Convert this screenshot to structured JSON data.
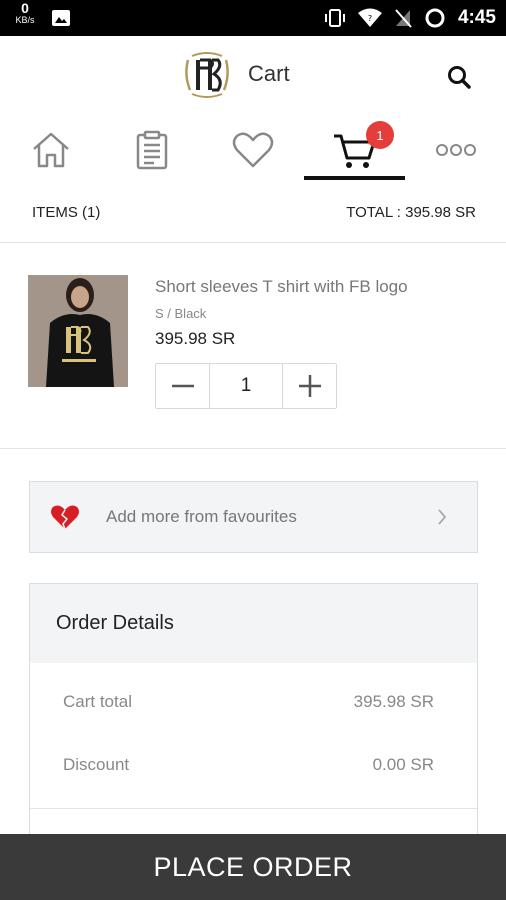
{
  "status_bar": {
    "net_speed": "0",
    "net_unit": "KB/s",
    "time": "4:45"
  },
  "header": {
    "title": "Cart"
  },
  "tabs": [
    {
      "name": "home",
      "icon": "home-icon"
    },
    {
      "name": "orders",
      "icon": "clipboard-icon"
    },
    {
      "name": "favourites",
      "icon": "heart-icon"
    },
    {
      "name": "cart",
      "icon": "cart-icon",
      "badge": "1",
      "active": true
    },
    {
      "name": "more",
      "icon": "more-icon"
    }
  ],
  "summary": {
    "items": "ITEMS (1)",
    "total": "TOTAL : 395.98 SR"
  },
  "cart_item": {
    "name": "Short sleeves T shirt with FB logo",
    "variant": "S / Black",
    "price": "395.98 SR",
    "quantity": "1"
  },
  "favourites": {
    "label": "Add more from favourites"
  },
  "order_details": {
    "title": "Order Details",
    "rows": [
      {
        "label": "Cart total",
        "value": "395.98 SR"
      },
      {
        "label": "Discount",
        "value": "0.00 SR"
      }
    ]
  },
  "place_order": {
    "label": "PLACE ORDER"
  },
  "colors": {
    "badge": "#e53c3c",
    "button_bg": "#3a3a3a",
    "panel_bg": "#f2f4f6",
    "heart": "#d81e25"
  }
}
